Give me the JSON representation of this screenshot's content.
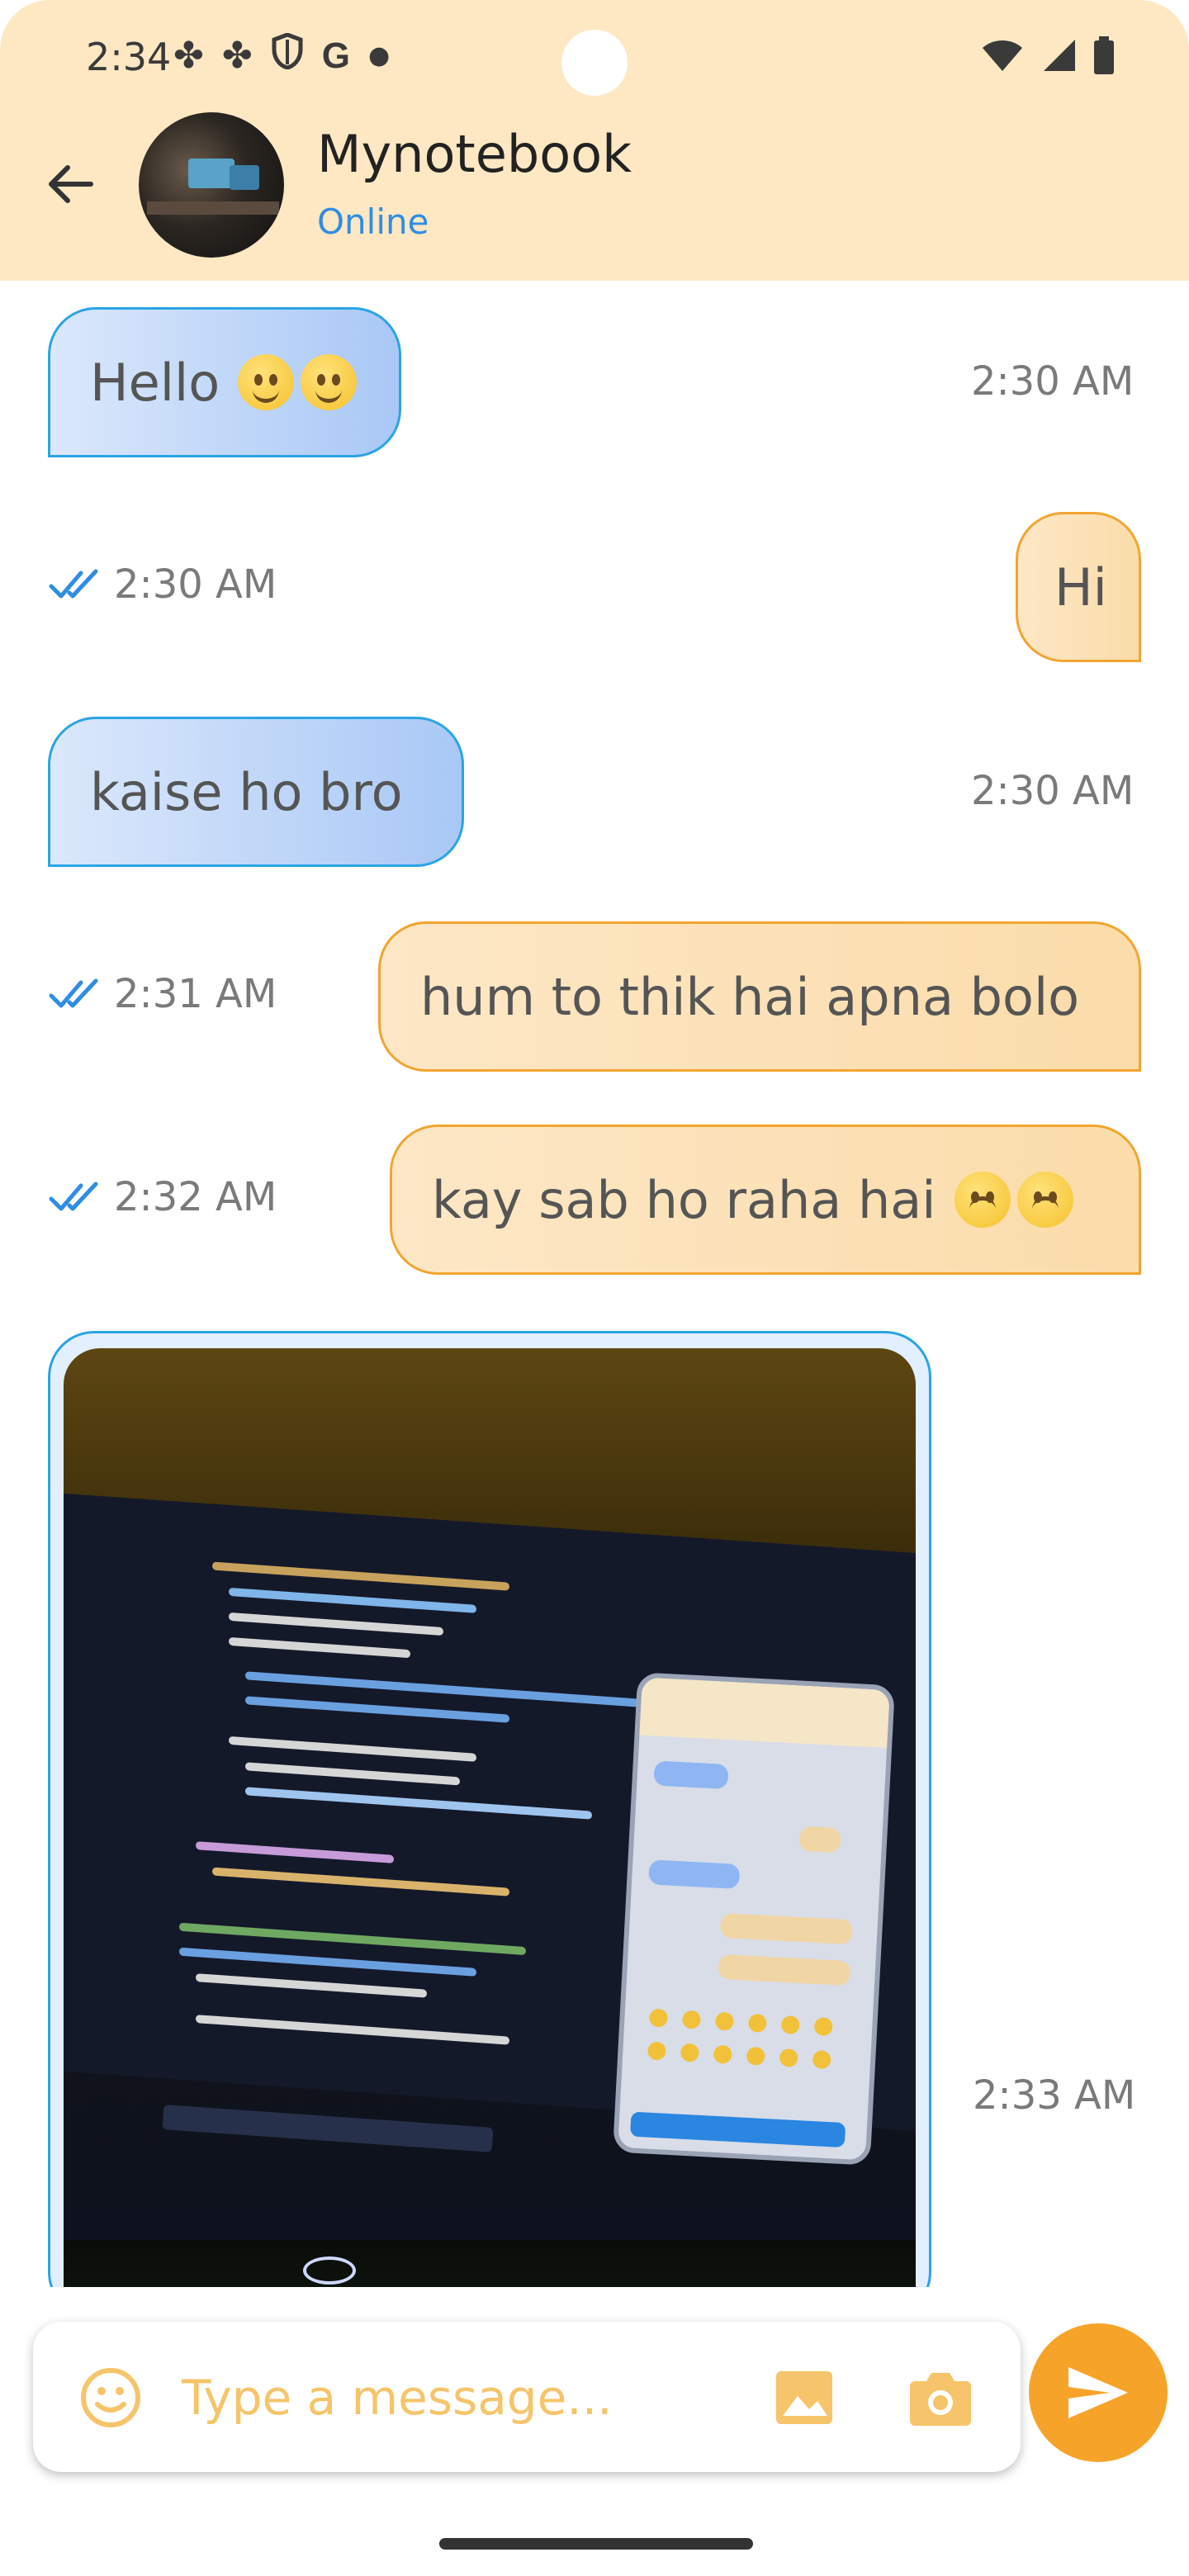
{
  "status_bar": {
    "time": "2:34",
    "left_icons": [
      "fan-icon",
      "fan-icon",
      "shield-icon",
      "google-icon",
      "dot-icon"
    ],
    "right_icons": [
      "wifi-icon",
      "signal-icon",
      "battery-icon"
    ]
  },
  "header": {
    "contact_name": "Mynotebook",
    "contact_status": "Online"
  },
  "messages": [
    {
      "direction": "incoming",
      "text": "Hello",
      "emoji": [
        "grinning-face",
        "grinning-face"
      ],
      "time": "2:30 AM"
    },
    {
      "direction": "outgoing",
      "text": "Hi",
      "time": "2:30 AM",
      "read": true
    },
    {
      "direction": "incoming",
      "text": "kaise ho bro",
      "time": "2:30 AM"
    },
    {
      "direction": "outgoing",
      "text": "hum to thik hai apna bolo",
      "time": "2:31 AM",
      "read": true
    },
    {
      "direction": "outgoing",
      "text": "kay sab ho raha hai",
      "emoji": [
        "upside-down-face",
        "upside-down-face"
      ],
      "time": "2:32 AM",
      "read": true
    },
    {
      "direction": "incoming",
      "type": "image",
      "image_description": "photo of laptop screen showing code editor and phone emulator",
      "time": "2:33 AM"
    }
  ],
  "input": {
    "placeholder": "Type a message..."
  },
  "colors": {
    "header_bg": "#fde8c3",
    "incoming_border": "#2aa4e6",
    "outgoing_border": "#f2a530",
    "accent": "#f6a32a",
    "online": "#2f8de4",
    "read_ticks": "#2f8de4"
  }
}
